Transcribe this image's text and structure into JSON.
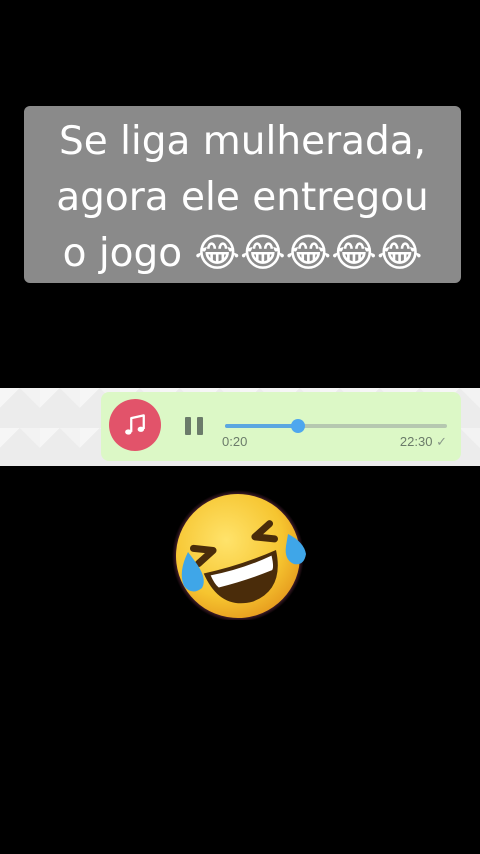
{
  "caption": {
    "line1": "Se liga mulherada,",
    "line2": "agora ele entregou",
    "line3": "o jogo 😂😂😂😂😂"
  },
  "audio": {
    "elapsed": "0:20",
    "timestamp": "22:30",
    "read_mark": "✓",
    "progress": 0.33,
    "icon": "music-note-icon",
    "accent": "#e2536a",
    "bubble_color": "#dcf8c6"
  },
  "emoji": {
    "name": "rolling-on-floor-laughing"
  }
}
